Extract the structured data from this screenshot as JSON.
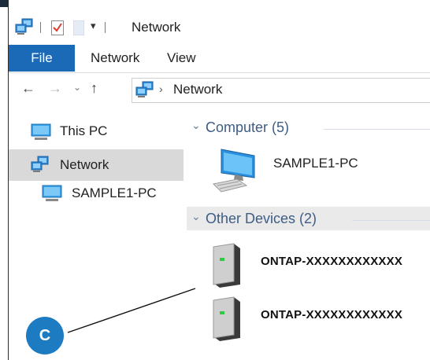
{
  "window": {
    "title": "Network",
    "ribbon_tabs": [
      "File",
      "Network",
      "View"
    ]
  },
  "address_bar": {
    "path": [
      "Network"
    ]
  },
  "nav_pane": {
    "items": [
      {
        "label": "This PC",
        "icon": "computer-icon",
        "selected": false
      },
      {
        "label": "Network",
        "icon": "network-icon",
        "selected": true
      },
      {
        "label": "SAMPLE1-PC",
        "icon": "computer-icon",
        "selected": false
      }
    ]
  },
  "content": {
    "groups": [
      {
        "header": "Computer (5)",
        "items": [
          {
            "label": "SAMPLE1-PC",
            "icon": "desktop-pc-icon"
          }
        ]
      },
      {
        "header": "Other Devices (2)",
        "items": [
          {
            "label": "ONTAP-XXXXXXXXXXXX",
            "icon": "storage-device-icon"
          },
          {
            "label": "ONTAP-XXXXXXXXXXXX",
            "icon": "storage-device-icon"
          }
        ]
      }
    ]
  },
  "callout": {
    "label": "C",
    "color": "#1d7cc1"
  },
  "colors": {
    "file_tab": "#1a6ab8",
    "group_header_text": "#3e5c84",
    "selection": "#d9d9d9"
  }
}
